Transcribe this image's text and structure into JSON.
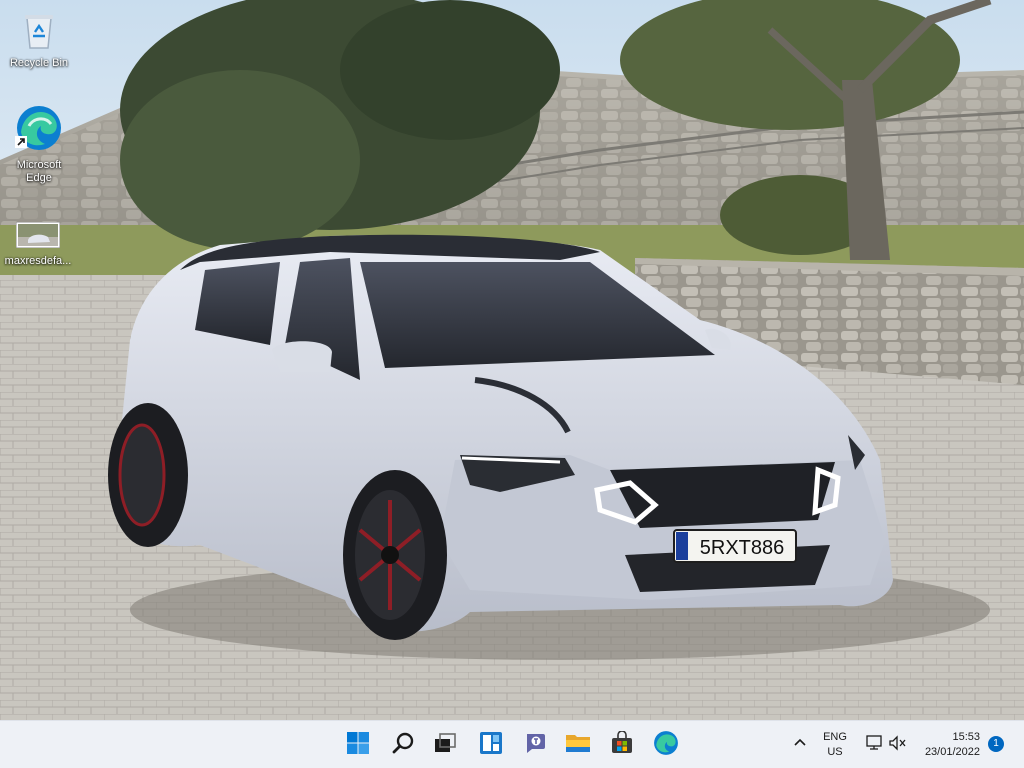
{
  "desktop": {
    "icons": [
      {
        "label": "Recycle Bin"
      },
      {
        "label": "Microsoft Edge"
      },
      {
        "label": "maxresdefa..."
      }
    ]
  },
  "wallpaper": {
    "plate_text": "5RXT886"
  },
  "taskbar": {
    "apps": [
      {
        "icon": "windows-start-icon"
      },
      {
        "icon": "search-icon"
      },
      {
        "icon": "task-view-icon"
      },
      {
        "icon": "widgets-icon"
      },
      {
        "icon": "teams-chat-icon"
      },
      {
        "icon": "file-explorer-icon"
      },
      {
        "icon": "microsoft-store-icon"
      },
      {
        "icon": "edge-icon"
      }
    ],
    "tray": {
      "language_line1": "ENG",
      "language_line2": "US",
      "time": "15:53",
      "date": "23/01/2022",
      "notification_count": "1"
    },
    "colors": {
      "accent": "#0067c0",
      "background": "#eef1f6"
    }
  }
}
